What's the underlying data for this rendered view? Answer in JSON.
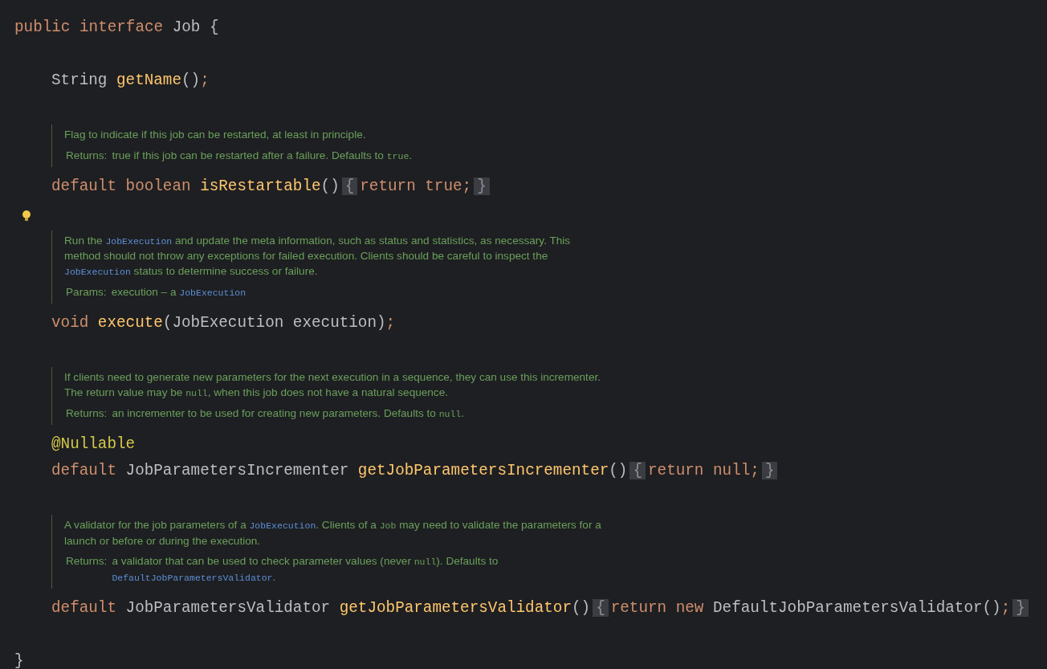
{
  "declaration": [
    {
      "text": "public interface ",
      "kind": "keyword"
    },
    {
      "text": "Job {",
      "kind": "plain"
    }
  ],
  "members": [
    {
      "kind": "code",
      "tokens": [
        {
          "text": "String ",
          "kind": "plain"
        },
        {
          "text": "getName",
          "kind": "method"
        },
        {
          "text": "()",
          "kind": "plain"
        },
        {
          "text": ";",
          "kind": "keyword"
        }
      ]
    },
    {
      "kind": "doc",
      "lightbulb": false,
      "description": [
        {
          "text": "Flag to indicate if this job can be restarted, at least in principle.",
          "kind": "text"
        }
      ],
      "tags": [
        {
          "label": "Returns:",
          "content": [
            {
              "text": "true if this job can be restarted after a failure. Defaults to ",
              "kind": "text"
            },
            {
              "text": "true",
              "kind": "code"
            },
            {
              "text": ".",
              "kind": "text"
            }
          ]
        }
      ]
    },
    {
      "kind": "code",
      "tokens": [
        {
          "text": "default boolean ",
          "kind": "keyword"
        },
        {
          "text": "isRestartable",
          "kind": "method"
        },
        {
          "text": "()",
          "kind": "plain"
        },
        {
          "text": "{",
          "kind": "fold"
        },
        {
          "text": "return true;",
          "kind": "keyword"
        },
        {
          "text": "}",
          "kind": "fold"
        }
      ]
    },
    {
      "kind": "doc",
      "lightbulb": true,
      "description": [
        {
          "text": "Run the ",
          "kind": "text"
        },
        {
          "text": "JobExecution",
          "kind": "link"
        },
        {
          "text": " and update the meta information, such as status and statistics, as necessary. This method should not throw any exceptions for failed execution. Clients should be careful to inspect the ",
          "kind": "text"
        },
        {
          "text": "JobExecution",
          "kind": "link"
        },
        {
          "text": " status to determine success or failure.",
          "kind": "text"
        }
      ],
      "tags": [
        {
          "label": "Params:",
          "content": [
            {
              "text": "execution – a ",
              "kind": "text"
            },
            {
              "text": "JobExecution",
              "kind": "link"
            }
          ]
        }
      ]
    },
    {
      "kind": "code",
      "tokens": [
        {
          "text": "void ",
          "kind": "keyword"
        },
        {
          "text": "execute",
          "kind": "method"
        },
        {
          "text": "(JobExecution execution)",
          "kind": "plain"
        },
        {
          "text": ";",
          "kind": "keyword"
        }
      ]
    },
    {
      "kind": "doc",
      "lightbulb": false,
      "description": [
        {
          "text": "If clients need to generate new parameters for the next execution in a sequence, they can use this incrementer. The return value may be ",
          "kind": "text"
        },
        {
          "text": "null",
          "kind": "code"
        },
        {
          "text": ", when this job does not have a natural sequence.",
          "kind": "text"
        }
      ],
      "tags": [
        {
          "label": "Returns:",
          "content": [
            {
              "text": "an incrementer to be used for creating new parameters. Defaults to ",
              "kind": "text"
            },
            {
              "text": "null",
              "kind": "code"
            },
            {
              "text": ".",
              "kind": "text"
            }
          ]
        }
      ]
    },
    {
      "kind": "code",
      "tokens": [
        {
          "text": "@Nullable",
          "kind": "annotation"
        }
      ]
    },
    {
      "kind": "code",
      "tokens": [
        {
          "text": "default ",
          "kind": "keyword"
        },
        {
          "text": "JobParametersIncrementer ",
          "kind": "plain"
        },
        {
          "text": "getJobParametersIncrementer",
          "kind": "method"
        },
        {
          "text": "()",
          "kind": "plain"
        },
        {
          "text": "{",
          "kind": "fold"
        },
        {
          "text": "return null;",
          "kind": "keyword"
        },
        {
          "text": "}",
          "kind": "fold"
        }
      ]
    },
    {
      "kind": "doc",
      "lightbulb": false,
      "description": [
        {
          "text": "A validator for the job parameters of a ",
          "kind": "text"
        },
        {
          "text": "JobExecution",
          "kind": "link"
        },
        {
          "text": ". Clients of a ",
          "kind": "text"
        },
        {
          "text": "Job",
          "kind": "code"
        },
        {
          "text": " may need to validate the parameters for a launch or before or during the execution.",
          "kind": "text"
        }
      ],
      "tags": [
        {
          "label": "Returns:",
          "content": [
            {
              "text": "a validator that can be used to check parameter values (never ",
              "kind": "text"
            },
            {
              "text": "null",
              "kind": "code"
            },
            {
              "text": "). Defaults to ",
              "kind": "text"
            },
            {
              "text": "DefaultJobParametersValidator",
              "kind": "link"
            },
            {
              "text": ".",
              "kind": "text"
            }
          ]
        }
      ]
    },
    {
      "kind": "code",
      "tokens": [
        {
          "text": "default ",
          "kind": "keyword"
        },
        {
          "text": "JobParametersValidator ",
          "kind": "plain"
        },
        {
          "text": "getJobParametersValidator",
          "kind": "method"
        },
        {
          "text": "()",
          "kind": "plain"
        },
        {
          "text": "{",
          "kind": "fold"
        },
        {
          "text": "return new ",
          "kind": "keyword"
        },
        {
          "text": "DefaultJobParametersValidator()",
          "kind": "plain"
        },
        {
          "text": ";",
          "kind": "keyword"
        },
        {
          "text": "}",
          "kind": "fold"
        }
      ]
    }
  ],
  "closing": [
    {
      "text": "}",
      "kind": "plain"
    }
  ]
}
